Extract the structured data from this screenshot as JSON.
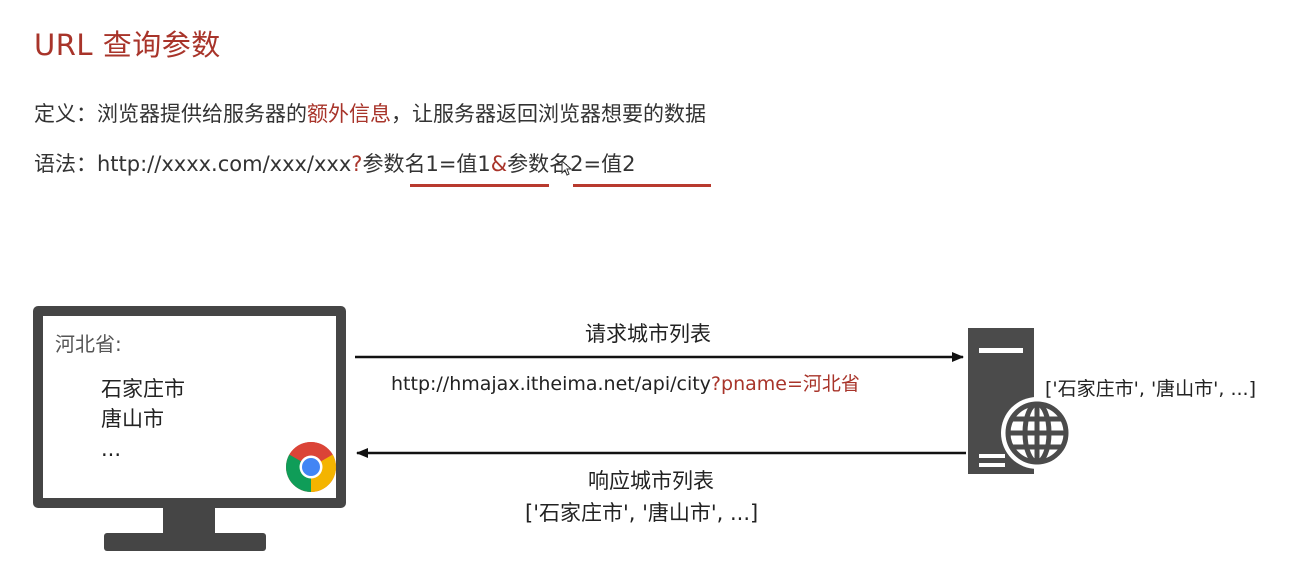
{
  "title": "URL 查询参数",
  "definition": {
    "prefix": "定义：浏览器提供给服务器的",
    "highlight": "额外信息",
    "suffix": "，让服务器返回浏览器想要的数据"
  },
  "syntax": {
    "prefix": "语法：http://xxxx.com/xxx/xxx",
    "question_mark": "?",
    "param1": "参数名1=值1",
    "ampersand": "&",
    "param2": "参数名2=值2"
  },
  "browser": {
    "heading": "河北省:",
    "items": [
      "石家庄市",
      "唐山市",
      "..."
    ]
  },
  "request": {
    "label": "请求城市列表",
    "url_base": "http://hmajax.itheima.net/api/city",
    "url_query": "?pname=河北省"
  },
  "response": {
    "label": "响应城市列表",
    "data": "['石家庄市', '唐山市', ...]"
  },
  "server": {
    "data": "['石家庄市', '唐山市', ...]"
  },
  "icons": {
    "browser": "chrome-icon",
    "server": "server-icon",
    "globe": "globe-icon"
  },
  "colors": {
    "accent": "#a8342a",
    "dark": "#454545",
    "text": "#333333"
  }
}
